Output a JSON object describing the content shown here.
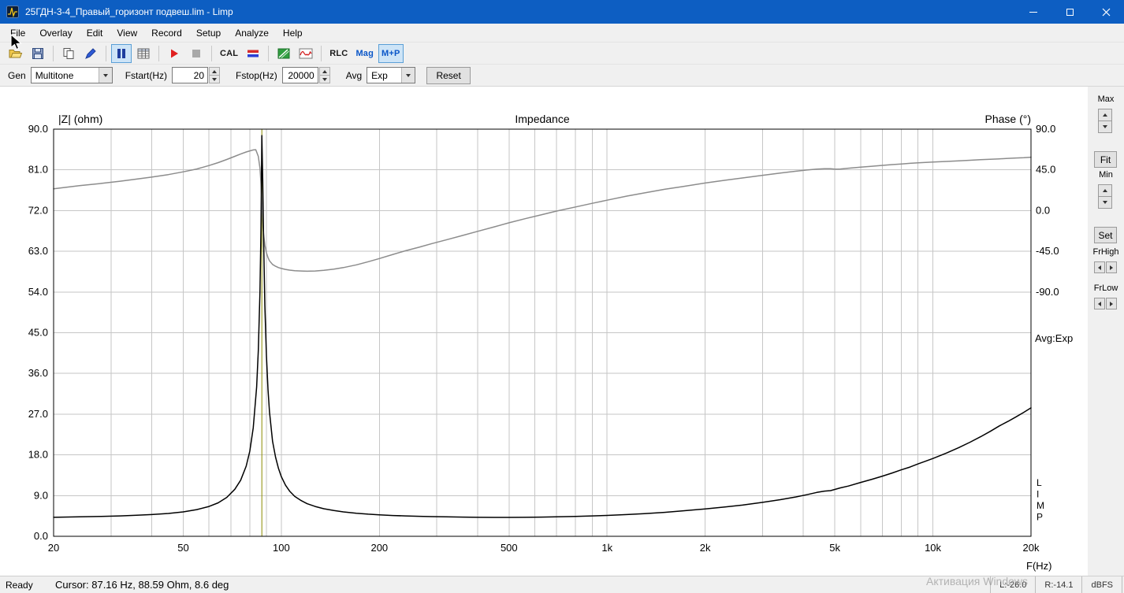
{
  "window": {
    "title": "25ГДН-3-4_Правый_горизонт подвеш.lim - Limp"
  },
  "menu": {
    "items": [
      "File",
      "Overlay",
      "Edit",
      "View",
      "Record",
      "Setup",
      "Analyze",
      "Help"
    ]
  },
  "toolbar": {
    "icon_names": [
      "open-file",
      "save",
      "copy",
      "pen",
      "pause",
      "data-table",
      "record-play",
      "stop",
      "level-meter",
      "spectrum",
      "signal-waveform"
    ],
    "cal_label": "CAL",
    "rlc_label": "RLC",
    "mag_label": "Mag",
    "mp_label": "M+P"
  },
  "genbar": {
    "gen_label": "Gen",
    "gen_value": "Multitone",
    "fstart_label": "Fstart(Hz)",
    "fstart_value": "20",
    "fstop_label": "Fstop(Hz)",
    "fstop_value": "20000",
    "avg_label": "Avg",
    "avg_value": "Exp",
    "reset_label": "Reset"
  },
  "right_panel": {
    "max_label": "Max",
    "fit_label": "Fit",
    "min_label": "Min",
    "set_label": "Set",
    "frhigh_label": "FrHigh",
    "frlow_label": "FrLow"
  },
  "statusbar": {
    "ready": "Ready",
    "cursor_text": "Cursor: 87.16 Hz, 88.59 Ohm, 8.6 deg",
    "left_level": "L:-26.0",
    "right_level": "R:-14.1",
    "units": "dBFS",
    "watermark": "Активация Windows"
  },
  "chart_data": {
    "type": "line",
    "title": "Impedance",
    "grid": true,
    "grid_color": "#c6c6c6",
    "x_axis": {
      "label": "F(Hz)",
      "scale": "log",
      "min": 20,
      "max": 20000,
      "gridlines": [
        30,
        40,
        50,
        60,
        70,
        80,
        90,
        100,
        200,
        300,
        400,
        500,
        600,
        700,
        800,
        900,
        1000,
        2000,
        3000,
        4000,
        5000,
        6000,
        7000,
        8000,
        9000,
        10000
      ],
      "ticks": [
        {
          "value": 20,
          "label": "20"
        },
        {
          "value": 50,
          "label": "50"
        },
        {
          "value": 100,
          "label": "100"
        },
        {
          "value": 200,
          "label": "200"
        },
        {
          "value": 500,
          "label": "500"
        },
        {
          "value": 1000,
          "label": "1k"
        },
        {
          "value": 2000,
          "label": "2k"
        },
        {
          "value": 5000,
          "label": "5k"
        },
        {
          "value": 10000,
          "label": "10k"
        },
        {
          "value": 20000,
          "label": "20k"
        }
      ]
    },
    "y_left": {
      "label": "|Z| (ohm)",
      "min": 0,
      "max": 90,
      "ticks": [
        {
          "value": 90,
          "label": "90.0"
        },
        {
          "value": 81,
          "label": "81.0"
        },
        {
          "value": 72,
          "label": "72.0"
        },
        {
          "value": 63,
          "label": "63.0"
        },
        {
          "value": 54,
          "label": "54.0"
        },
        {
          "value": 45,
          "label": "45.0"
        },
        {
          "value": 36,
          "label": "36.0"
        },
        {
          "value": 27,
          "label": "27.0"
        },
        {
          "value": 18,
          "label": "18.0"
        },
        {
          "value": 9,
          "label": "9.0"
        },
        {
          "value": 0,
          "label": "0.0"
        }
      ]
    },
    "y_right": {
      "label": "Phase (°)",
      "unit": "deg",
      "zero_at_left_value": 72,
      "ohm_per_degree": 0.2,
      "ticks": [
        {
          "value": 90,
          "label": "90.0"
        },
        {
          "value": 45,
          "label": "45.0"
        },
        {
          "value": 0,
          "label": "0.0"
        },
        {
          "value": -45,
          "label": "-45.0"
        },
        {
          "value": -90,
          "label": "-90.0"
        }
      ]
    },
    "annotations": {
      "avg_mode": "Avg:Exp",
      "logo_vertical": "LIMP"
    },
    "cursor": {
      "freq_hz": 87.16,
      "impedance_ohm": 88.59,
      "phase_deg": 8.6,
      "color": "#8b8b00"
    },
    "series": [
      {
        "name": "phase",
        "axis": "right",
        "color": "#8c8c8c",
        "points": [
          [
            20,
            24
          ],
          [
            24,
            27.5
          ],
          [
            28,
            30
          ],
          [
            32,
            32.5
          ],
          [
            36,
            34.8
          ],
          [
            40,
            37
          ],
          [
            45,
            39.8
          ],
          [
            50,
            42.8
          ],
          [
            55,
            46
          ],
          [
            60,
            49.8
          ],
          [
            64,
            53
          ],
          [
            68,
            56.5
          ],
          [
            72,
            60
          ],
          [
            75,
            62.5
          ],
          [
            78,
            64.8
          ],
          [
            80,
            66
          ],
          [
            82,
            67
          ],
          [
            83.5,
            67.3
          ],
          [
            85,
            60
          ],
          [
            86,
            47
          ],
          [
            86.6,
            30
          ],
          [
            87.16,
            8.6
          ],
          [
            87.7,
            -12
          ],
          [
            88.2,
            -26
          ],
          [
            89,
            -38
          ],
          [
            90,
            -46.5
          ],
          [
            91,
            -52
          ],
          [
            92,
            -55.5
          ],
          [
            94,
            -59.5
          ],
          [
            96,
            -61.5
          ],
          [
            98,
            -63
          ],
          [
            100,
            -64
          ],
          [
            103,
            -65
          ],
          [
            106,
            -65.8
          ],
          [
            110,
            -66.4
          ],
          [
            115,
            -66.8
          ],
          [
            120,
            -67
          ],
          [
            127,
            -66.8
          ],
          [
            135,
            -66
          ],
          [
            145,
            -64.8
          ],
          [
            155,
            -63
          ],
          [
            170,
            -60
          ],
          [
            185,
            -56.5
          ],
          [
            200,
            -53
          ],
          [
            220,
            -48.5
          ],
          [
            240,
            -44.5
          ],
          [
            265,
            -40.5
          ],
          [
            290,
            -36.5
          ],
          [
            320,
            -32.5
          ],
          [
            360,
            -27.5
          ],
          [
            400,
            -23
          ],
          [
            450,
            -18
          ],
          [
            500,
            -13.5
          ],
          [
            560,
            -9
          ],
          [
            630,
            -4.5
          ],
          [
            700,
            -0.5
          ],
          [
            800,
            4
          ],
          [
            900,
            8
          ],
          [
            1000,
            11.5
          ],
          [
            1150,
            16
          ],
          [
            1300,
            19.5
          ],
          [
            1500,
            23.5
          ],
          [
            1700,
            26.5
          ],
          [
            2000,
            30.5
          ],
          [
            2300,
            33.5
          ],
          [
            2600,
            36
          ],
          [
            3000,
            39
          ],
          [
            3400,
            41.5
          ],
          [
            3800,
            43.5
          ],
          [
            4100,
            44.8
          ],
          [
            4400,
            45.8
          ],
          [
            4650,
            46.3
          ],
          [
            4850,
            46.2
          ],
          [
            5000,
            45.8
          ],
          [
            5200,
            46
          ],
          [
            5500,
            46.8
          ],
          [
            6000,
            48
          ],
          [
            6500,
            49
          ],
          [
            7000,
            50
          ],
          [
            7500,
            50.8
          ],
          [
            8000,
            51.5
          ],
          [
            8500,
            52.2
          ],
          [
            9000,
            52.8
          ],
          [
            9500,
            53.2
          ],
          [
            10000,
            53.6
          ],
          [
            11000,
            54.3
          ],
          [
            12000,
            55
          ],
          [
            13000,
            55.6
          ],
          [
            14000,
            56.2
          ],
          [
            15000,
            56.7
          ],
          [
            16000,
            57.2
          ],
          [
            17000,
            57.7
          ],
          [
            18000,
            58.1
          ],
          [
            19000,
            58.5
          ],
          [
            20000,
            59
          ]
        ]
      },
      {
        "name": "impedance",
        "axis": "left",
        "color": "#000000",
        "points": [
          [
            20,
            4.2
          ],
          [
            24,
            4.3
          ],
          [
            28,
            4.4
          ],
          [
            32,
            4.5
          ],
          [
            36,
            4.65
          ],
          [
            40,
            4.8
          ],
          [
            45,
            5.05
          ],
          [
            50,
            5.4
          ],
          [
            55,
            5.9
          ],
          [
            60,
            6.6
          ],
          [
            64,
            7.4
          ],
          [
            68,
            8.6
          ],
          [
            72,
            10.4
          ],
          [
            75,
            12.4
          ],
          [
            78,
            15.5
          ],
          [
            80,
            18.8
          ],
          [
            82,
            24
          ],
          [
            84,
            33
          ],
          [
            85,
            41
          ],
          [
            86,
            54
          ],
          [
            86.6,
            68
          ],
          [
            87.16,
            88.59
          ],
          [
            87.7,
            79
          ],
          [
            88.2,
            66
          ],
          [
            89,
            51
          ],
          [
            90,
            40
          ],
          [
            91,
            32.5
          ],
          [
            92,
            27.5
          ],
          [
            94,
            21
          ],
          [
            96,
            17.5
          ],
          [
            98,
            15
          ],
          [
            100,
            13.2
          ],
          [
            103,
            11.3
          ],
          [
            106,
            10
          ],
          [
            110,
            8.8
          ],
          [
            115,
            7.9
          ],
          [
            120,
            7.2
          ],
          [
            127,
            6.6
          ],
          [
            135,
            6.1
          ],
          [
            145,
            5.7
          ],
          [
            155,
            5.4
          ],
          [
            170,
            5.1
          ],
          [
            185,
            4.9
          ],
          [
            200,
            4.75
          ],
          [
            220,
            4.6
          ],
          [
            240,
            4.5
          ],
          [
            265,
            4.42
          ],
          [
            290,
            4.35
          ],
          [
            320,
            4.3
          ],
          [
            360,
            4.25
          ],
          [
            400,
            4.2
          ],
          [
            450,
            4.18
          ],
          [
            500,
            4.18
          ],
          [
            560,
            4.2
          ],
          [
            630,
            4.25
          ],
          [
            700,
            4.3
          ],
          [
            800,
            4.4
          ],
          [
            900,
            4.5
          ],
          [
            1000,
            4.62
          ],
          [
            1150,
            4.8
          ],
          [
            1300,
            5.0
          ],
          [
            1500,
            5.3
          ],
          [
            1700,
            5.6
          ],
          [
            2000,
            6.05
          ],
          [
            2300,
            6.5
          ],
          [
            2600,
            6.9
          ],
          [
            3000,
            7.5
          ],
          [
            3400,
            8.1
          ],
          [
            3800,
            8.7
          ],
          [
            4100,
            9.2
          ],
          [
            4400,
            9.7
          ],
          [
            4650,
            10.0
          ],
          [
            4850,
            10.1
          ],
          [
            5000,
            10.35
          ],
          [
            5200,
            10.7
          ],
          [
            5500,
            11.1
          ],
          [
            6000,
            11.9
          ],
          [
            6500,
            12.6
          ],
          [
            7000,
            13.3
          ],
          [
            7500,
            14.0
          ],
          [
            8000,
            14.7
          ],
          [
            8500,
            15.3
          ],
          [
            9000,
            16.0
          ],
          [
            9500,
            16.6
          ],
          [
            10000,
            17.2
          ],
          [
            11000,
            18.4
          ],
          [
            12000,
            19.6
          ],
          [
            13000,
            20.8
          ],
          [
            14000,
            22.0
          ],
          [
            15000,
            23.2
          ],
          [
            16000,
            24.4
          ],
          [
            17000,
            25.4
          ],
          [
            18000,
            26.4
          ],
          [
            19000,
            27.4
          ],
          [
            20000,
            28.4
          ]
        ]
      }
    ]
  }
}
